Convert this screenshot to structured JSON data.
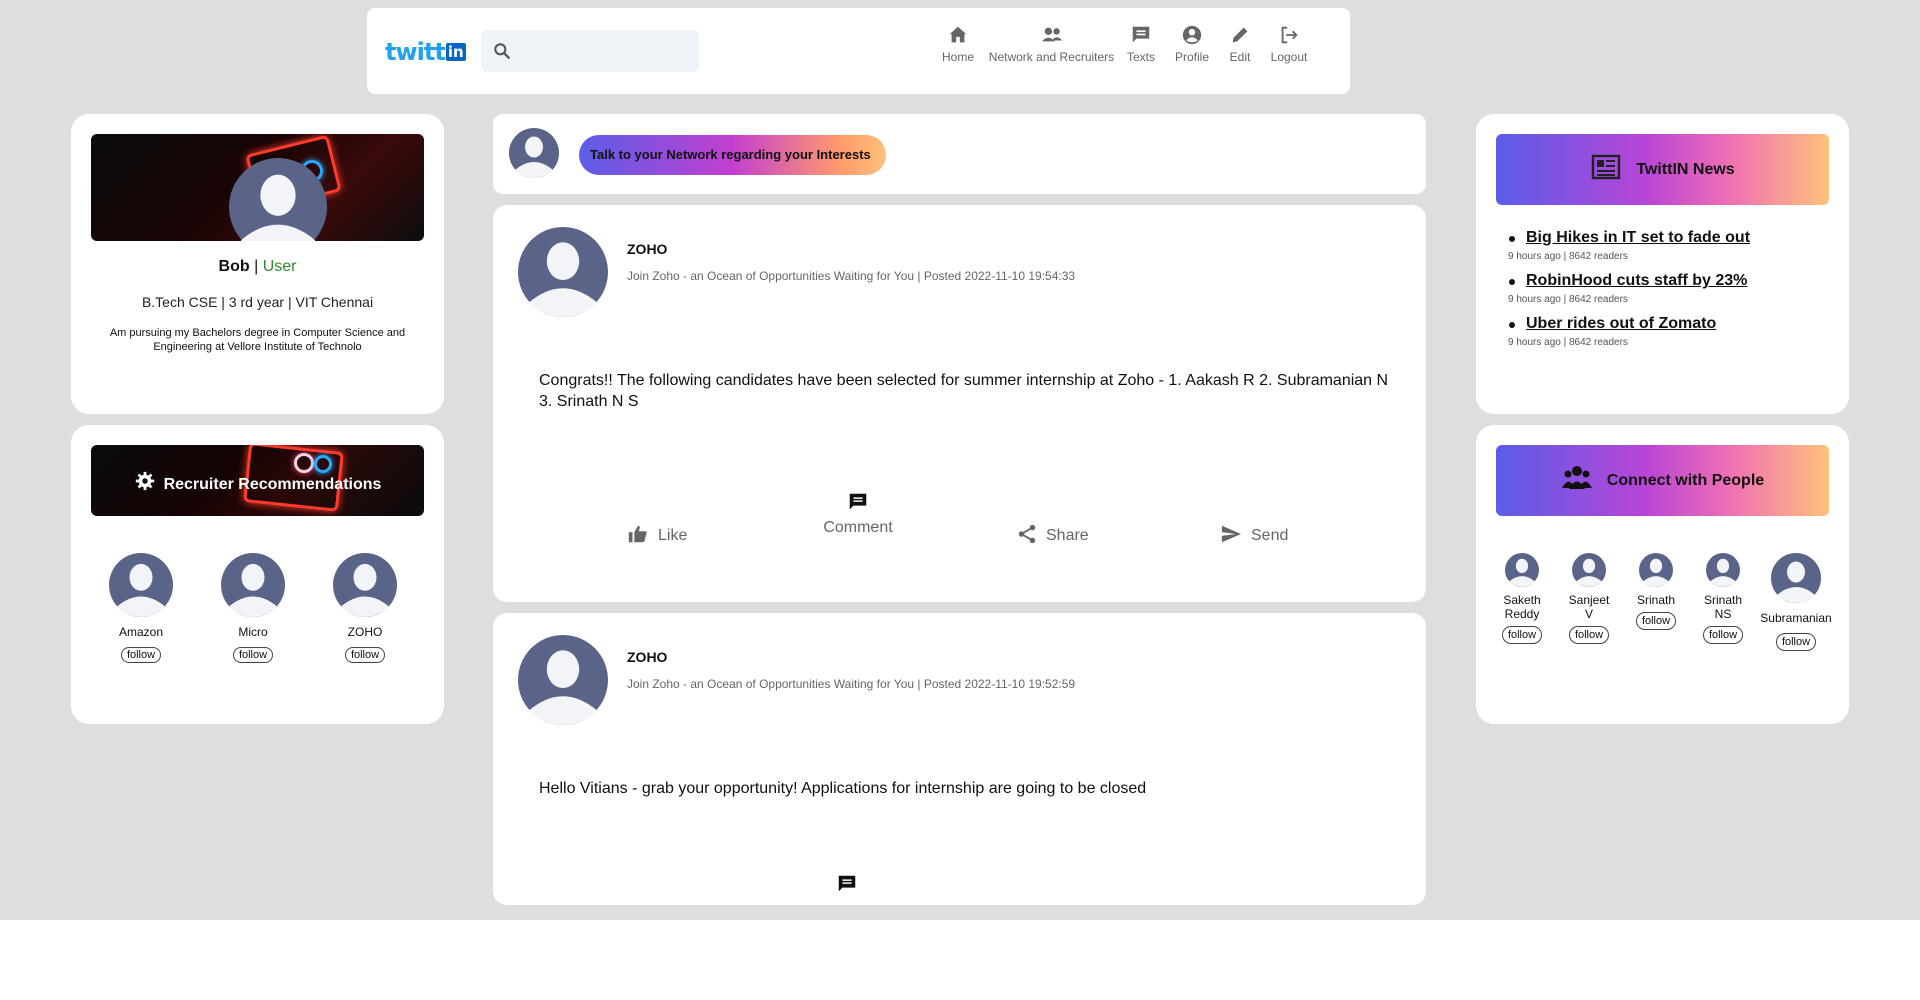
{
  "brand": {
    "logo_text": "twitt",
    "logo_badge": "in"
  },
  "search": {
    "placeholder": ""
  },
  "nav": [
    {
      "label": "Home",
      "icon": "home-icon"
    },
    {
      "label": "Network and Recruiters",
      "icon": "people-icon"
    },
    {
      "label": "Texts",
      "icon": "message-icon"
    },
    {
      "label": "Profile",
      "icon": "profile-icon"
    },
    {
      "label": "Edit",
      "icon": "pencil-icon"
    },
    {
      "label": "Logout",
      "icon": "logout-icon"
    }
  ],
  "profile": {
    "name": "Bob",
    "separator": " | ",
    "role": "User",
    "education": "B.Tech CSE | 3 rd year | VIT Chennai",
    "bio": "Am pursuing my Bachelors degree in Computer Science and Engineering at Vellore Institute of Technolo"
  },
  "recruiters": {
    "title": "Recruiter Recommendations",
    "items": [
      {
        "name": "Amazon",
        "button": "follow"
      },
      {
        "name": "Micro",
        "button": "follow"
      },
      {
        "name": "ZOHO",
        "button": "follow"
      }
    ]
  },
  "compose": {
    "button_label": "Talk to your Network regarding your Interests"
  },
  "posts": [
    {
      "author": "ZOHO",
      "subtitle": "Join Zoho - an Ocean of Opportunities Waiting for You | Posted 2022-11-10 19:54:33",
      "content": "Congrats!! The following candidates have been selected for summer internship at Zoho - 1. Aakash R 2. Subramanian N 3. Srinath N S",
      "actions": {
        "like": "Like",
        "comment": "Comment",
        "share": "Share",
        "send": "Send"
      }
    },
    {
      "author": "ZOHO",
      "subtitle": "Join Zoho - an Ocean of Opportunities Waiting for You | Posted 2022-11-10 19:52:59",
      "content": "Hello Vitians - grab your opportunity! Applications for internship are going to be closed"
    }
  ],
  "news": {
    "title": "TwittIN News",
    "items": [
      {
        "headline": "Big Hikes in IT set to fade out",
        "meta": "9 hours ago | 8642 readers"
      },
      {
        "headline": "RobinHood cuts staff by 23%",
        "meta": "9 hours ago | 8642 readers"
      },
      {
        "headline": "Uber rides out of Zomato",
        "meta": "9 hours ago | 8642 readers"
      }
    ]
  },
  "connect": {
    "title": "Connect with People",
    "people": [
      {
        "name": "Saketh Reddy",
        "button": "follow"
      },
      {
        "name": "Sanjeet V",
        "button": "follow"
      },
      {
        "name": "Srinath",
        "button": "follow"
      },
      {
        "name": "Srinath NS",
        "button": "follow"
      },
      {
        "name": "Subramanian",
        "button": "follow"
      }
    ]
  },
  "colors": {
    "accent_green": "#2e8b2e",
    "avatar": "#5a6489",
    "background": "#dedede"
  }
}
